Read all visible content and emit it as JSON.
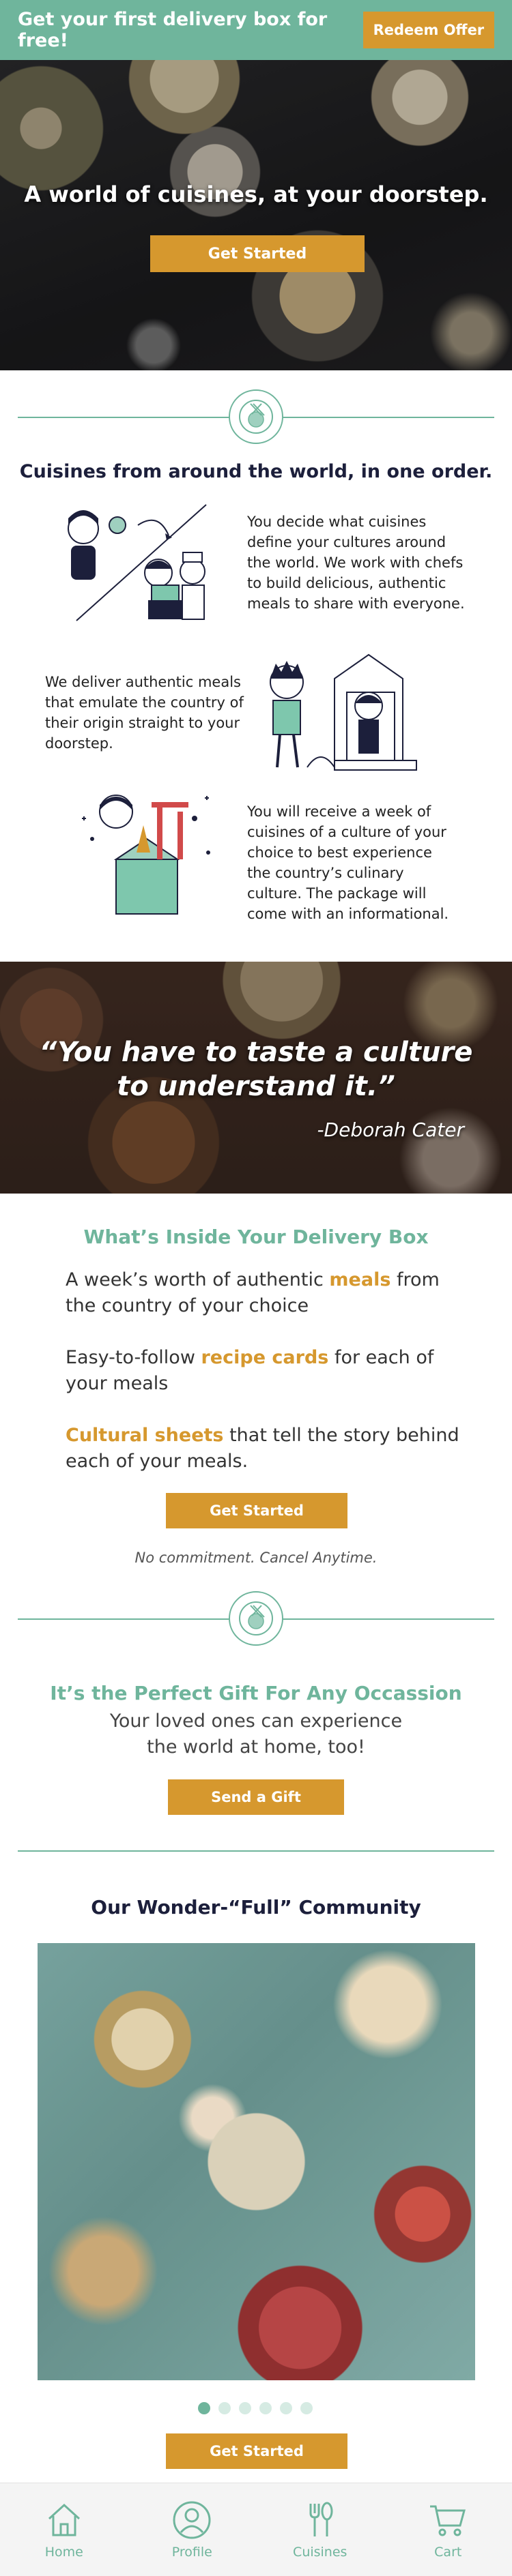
{
  "promo": {
    "text": "Get your first delivery box for free!",
    "button": "Redeem Offer"
  },
  "hero": {
    "title": "A world of cuisines, at your doorstep.",
    "button": "Get Started"
  },
  "how_it_works": {
    "title": "Cuisines from around the world, in one order.",
    "items": [
      {
        "text": "You decide what cuisines define your cultures around the world.  We work with chefs to build delicious, authentic meals to share with everyone."
      },
      {
        "text": "We deliver authentic meals that emulate the country of their origin straight to your doorstep."
      },
      {
        "text": "You will receive a week of cuisines of a culture of your choice to best experience the country’s culinary culture. The package will come with an informational."
      }
    ]
  },
  "quote": {
    "text": "“You have to taste a culture to understand it.”",
    "author": "-Deborah Cater"
  },
  "inside_box": {
    "title": "What’s Inside Your Delivery Box",
    "items": [
      {
        "before": "A week’s worth of authentic ",
        "highlight": "meals",
        "after": " from the country of your choice"
      },
      {
        "before": "Easy-to-follow ",
        "highlight": "recipe cards",
        "after": " for each of your meals"
      },
      {
        "before": "",
        "highlight": "Cultural sheets",
        "after": " that tell the story behind each of your meals."
      }
    ],
    "button": "Get Started",
    "note": "No commitment. Cancel Anytime."
  },
  "gift": {
    "title": "It’s the Perfect Gift For Any Occassion",
    "subtitle_line1": "Your loved ones can experience",
    "subtitle_line2": "the world at home, too!",
    "button": "Send a Gift"
  },
  "community": {
    "title": "Our Wonder-“Full” Community",
    "carousel_active": 1,
    "carousel_count": 6,
    "button": "Get Started"
  },
  "tabbar": {
    "items": [
      {
        "label": "Home",
        "icon": "home-icon"
      },
      {
        "label": "Profile",
        "icon": "profile-icon"
      },
      {
        "label": "Cuisines",
        "icon": "utensils-icon"
      },
      {
        "label": "Cart",
        "icon": "cart-icon"
      }
    ]
  },
  "colors": {
    "accent_green": "#6fb59c",
    "accent_orange": "#d6982e",
    "navy": "#1c1f3b"
  }
}
